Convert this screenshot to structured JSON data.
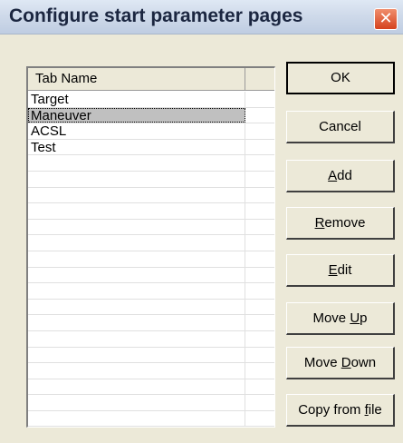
{
  "window": {
    "title": "Configure start parameter pages",
    "close_glyph": "✕"
  },
  "list": {
    "header": "Tab Name",
    "selected_index": 1,
    "rows": [
      "Target",
      "Maneuver",
      "ACSL",
      "Test",
      "",
      "",
      "",
      "",
      "",
      "",
      "",
      "",
      "",
      "",
      "",
      "",
      "",
      "",
      "",
      "",
      ""
    ]
  },
  "buttons": {
    "ok": "OK",
    "cancel": "Cancel",
    "add": {
      "pre": "",
      "key": "A",
      "post": "dd"
    },
    "remove": {
      "pre": "",
      "key": "R",
      "post": "emove"
    },
    "edit": {
      "pre": "",
      "key": "E",
      "post": "dit"
    },
    "move_up": {
      "pre": "Move ",
      "key": "U",
      "post": "p"
    },
    "move_down": {
      "pre": "Move ",
      "key": "D",
      "post": "own"
    },
    "copy_from_file": {
      "pre": "Copy from ",
      "key": "f",
      "post": "ile"
    }
  }
}
